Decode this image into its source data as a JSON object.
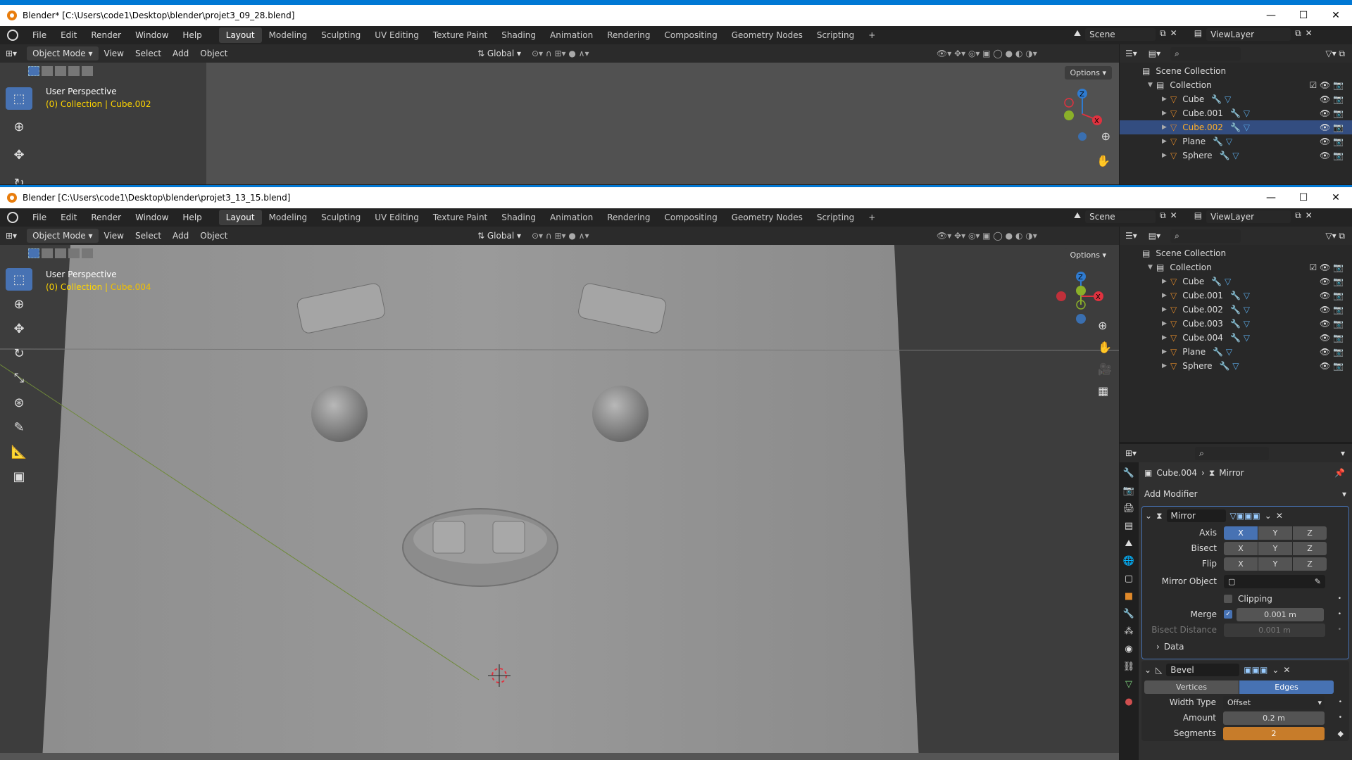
{
  "win1": {
    "title": "Blender* [C:\\Users\\code1\\Desktop\\blender\\projet3_09_28.blend]",
    "viewport_title": "User Perspective",
    "viewport_sub": "(0) Collection | Cube.002",
    "outliner": [
      {
        "label": "Scene Collection",
        "indent": 0,
        "type": "scene"
      },
      {
        "label": "Collection",
        "indent": 1,
        "type": "coll"
      },
      {
        "label": "Cube",
        "indent": 2,
        "type": "obj"
      },
      {
        "label": "Cube.001",
        "indent": 2,
        "type": "obj"
      },
      {
        "label": "Cube.002",
        "indent": 2,
        "type": "obj",
        "selected": true
      },
      {
        "label": "Plane",
        "indent": 2,
        "type": "obj"
      },
      {
        "label": "Sphere",
        "indent": 2,
        "type": "obj"
      }
    ]
  },
  "win2": {
    "title": "Blender [C:\\Users\\code1\\Desktop\\blender\\projet3_13_15.blend]",
    "viewport_title": "User Perspective",
    "viewport_sub_a": "(0) Collection | ",
    "viewport_sub_b": "Cube.004",
    "outliner": [
      {
        "label": "Scene Collection",
        "indent": 0,
        "type": "scene"
      },
      {
        "label": "Collection",
        "indent": 1,
        "type": "coll"
      },
      {
        "label": "Cube",
        "indent": 2,
        "type": "obj"
      },
      {
        "label": "Cube.001",
        "indent": 2,
        "type": "obj"
      },
      {
        "label": "Cube.002",
        "indent": 2,
        "type": "obj"
      },
      {
        "label": "Cube.003",
        "indent": 2,
        "type": "obj"
      },
      {
        "label": "Cube.004",
        "indent": 2,
        "type": "obj"
      },
      {
        "label": "Plane",
        "indent": 2,
        "type": "obj"
      },
      {
        "label": "Sphere",
        "indent": 2,
        "type": "obj"
      }
    ]
  },
  "menu": {
    "items": [
      "File",
      "Edit",
      "Render",
      "Window",
      "Help"
    ],
    "workspaces": [
      "Layout",
      "Modeling",
      "Sculpting",
      "UV Editing",
      "Texture Paint",
      "Shading",
      "Animation",
      "Rendering",
      "Compositing",
      "Geometry Nodes",
      "Scripting"
    ],
    "active_workspace": "Layout",
    "plus": "+",
    "scene": "Scene",
    "view_layer": "ViewLayer"
  },
  "header": {
    "mode": "Object Mode",
    "view": "View",
    "select": "Select",
    "add": "Add",
    "object": "Object",
    "orientation": "Global",
    "options": "Options"
  },
  "properties": {
    "breadcrumb_obj": "Cube.004",
    "breadcrumb_mod": "Mirror",
    "add_modifier": "Add Modifier",
    "mirror_name": "Mirror",
    "axis_label": "Axis",
    "bisect_label": "Bisect",
    "flip_label": "Flip",
    "x": "X",
    "y": "Y",
    "z": "Z",
    "mirror_object_label": "Mirror Object",
    "clipping_label": "Clipping",
    "merge_label": "Merge",
    "merge_value": "0.001 m",
    "bisect_distance_label": "Bisect Distance",
    "bisect_distance_value": "0.001 m",
    "data_label": "Data",
    "bevel_name": "Bevel",
    "vertices_label": "Vertices",
    "edges_label": "Edges",
    "width_type_label": "Width Type",
    "width_type_value": "Offset",
    "amount_label": "Amount",
    "amount_value": "0.2 m",
    "segments_label": "Segments",
    "segments_value": "2"
  },
  "colors": {
    "accent": "#4772b3",
    "selected_row": "#334d80",
    "viewport_bg": "#3d3d3d",
    "object_orange": "#e0892a",
    "gizmo_x": "#e0323f",
    "gizmo_y": "#8ab029",
    "gizmo_z": "#2f7bd0"
  }
}
